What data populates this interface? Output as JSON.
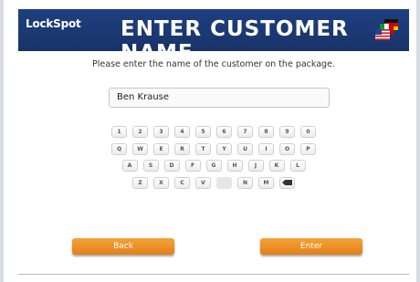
{
  "header": {
    "logo_text": "LockSpot",
    "title": "ENTER CUSTOMER NAME",
    "language_icon": "flags-language-icon"
  },
  "prompt": "Please enter the name of the customer on the package.",
  "name_input": {
    "value": "Ben Krause"
  },
  "keyboard": {
    "row1": [
      "1",
      "2",
      "3",
      "4",
      "5",
      "6",
      "7",
      "8",
      "9",
      "0"
    ],
    "row2": [
      "Q",
      "W",
      "E",
      "R",
      "T",
      "Y",
      "U",
      "I",
      "O",
      "P"
    ],
    "row3": [
      "A",
      "S",
      "D",
      "F",
      "G",
      "H",
      "J",
      "K",
      "L"
    ],
    "row4": [
      "Z",
      "X",
      "C",
      "V",
      "",
      "N",
      "M"
    ],
    "backspace_icon": "backspace-icon"
  },
  "buttons": {
    "back": "Back",
    "enter": "Enter"
  },
  "colors": {
    "header": "#1f3f80",
    "button": "#ee8f24"
  }
}
